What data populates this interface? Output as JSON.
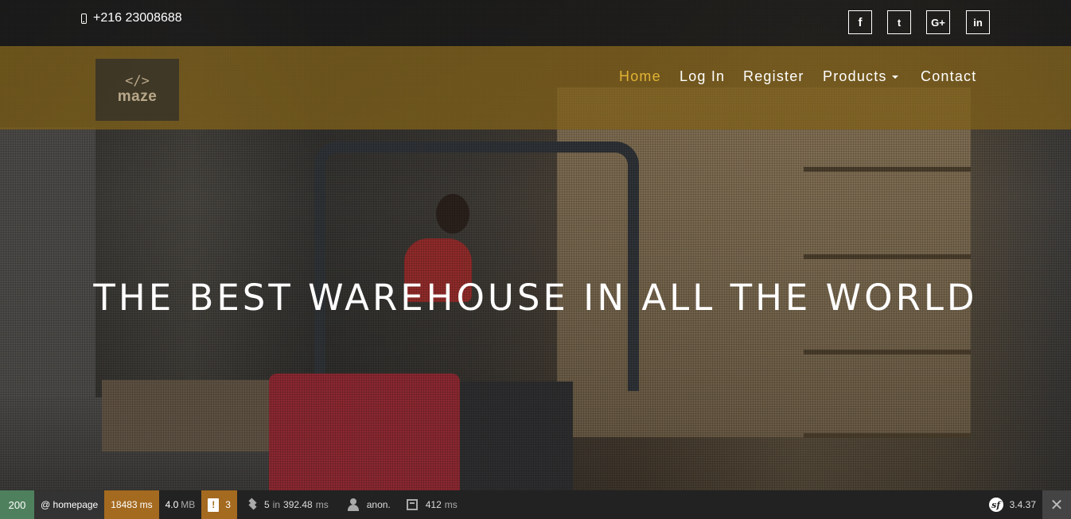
{
  "topbar": {
    "phone": "+216 23008688",
    "social": {
      "facebook": "f",
      "twitter": "t",
      "google": "G+",
      "linkedin": "in"
    }
  },
  "logo": {
    "code": "</>",
    "text": "maze"
  },
  "nav": {
    "items": [
      "Home",
      "Log In",
      "Register",
      "Products",
      "Contact"
    ],
    "active": "Home",
    "accent": "#e2b334"
  },
  "hero": {
    "headline": "THE BEST WAREHOUSE IN ALL THE WORLD"
  },
  "debug_toolbar": {
    "status": "200",
    "route": "@ homepage",
    "time_value": "18483",
    "time_unit": "ms",
    "memory_value": "4.0",
    "memory_unit": "MB",
    "logs": "3",
    "db_count": "5",
    "db_in": "in",
    "db_time": "392.48",
    "db_unit": "ms",
    "user": "anon.",
    "render_time": "412",
    "render_unit": "ms",
    "version": "3.4.37",
    "close": "✕",
    "status_color": "#4f805d",
    "warning_color": "#a46a20"
  }
}
